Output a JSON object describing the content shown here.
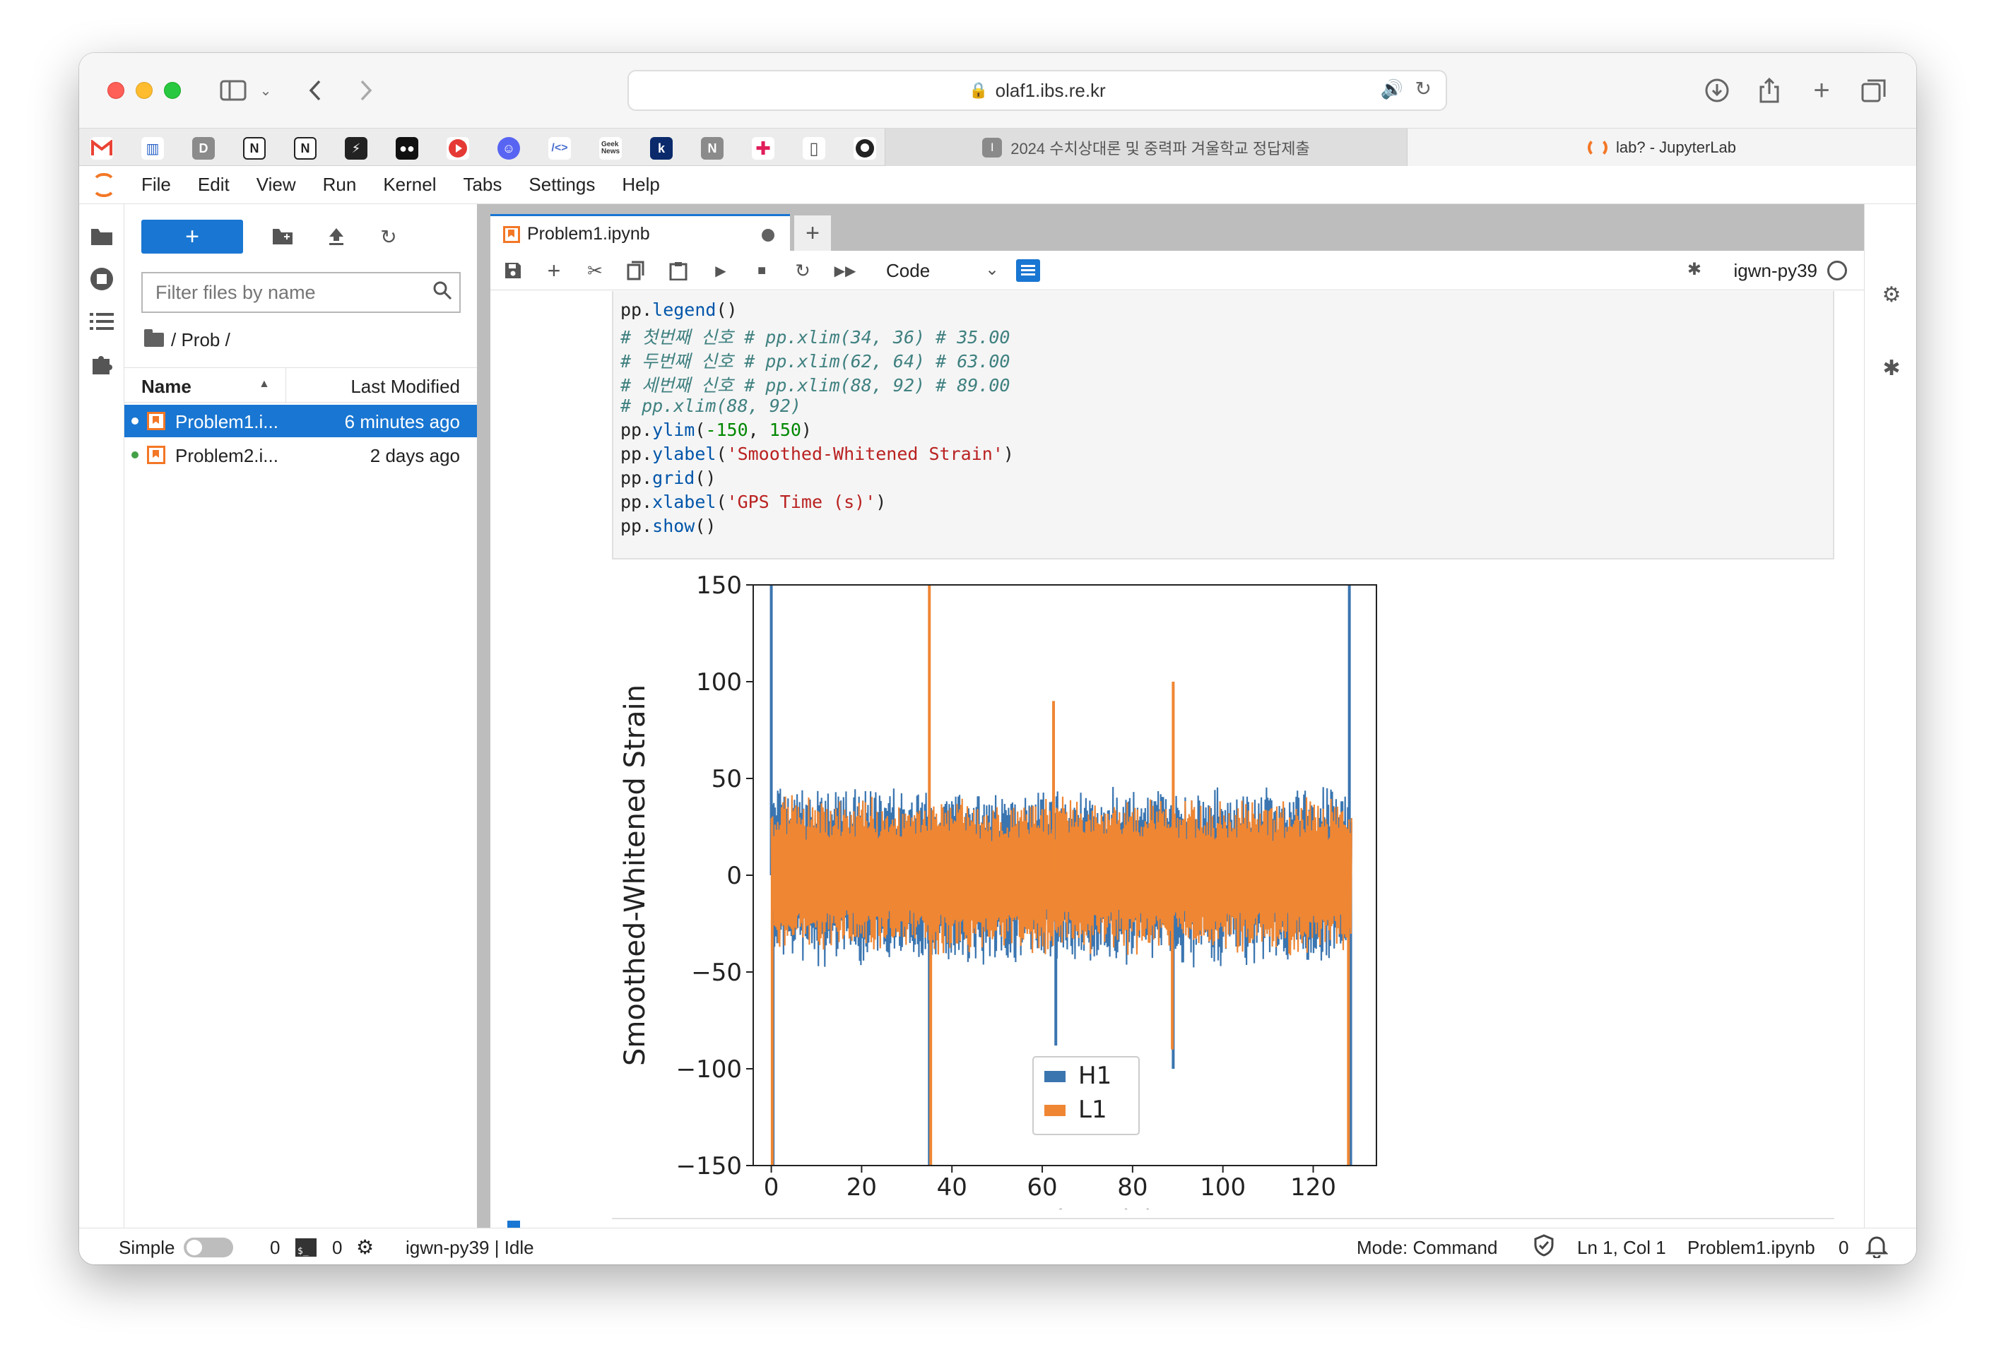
{
  "browser": {
    "url": "olaf1.ibs.re.kr",
    "tabs": [
      {
        "label": "2024 수치상대론 및 중력파 겨울학교 정답제출",
        "favicon": "I",
        "active": false
      },
      {
        "label": "lab? - JupyterLab",
        "active": true
      }
    ],
    "bookmarks": [
      "gmail-icon",
      "bookmark-barcode",
      "D",
      "notion-icon",
      "notion-icon",
      "bookmark-app",
      "medium-icon",
      "youtube-icon",
      "discord-icon",
      "/<>",
      "Geek News",
      "k",
      "N",
      "slack-icon",
      "reader-icon",
      "github-icon"
    ]
  },
  "jupyter": {
    "menu": [
      "File",
      "Edit",
      "View",
      "Run",
      "Kernel",
      "Tabs",
      "Settings",
      "Help"
    ],
    "filebrowser": {
      "new_label": "+",
      "filter_placeholder": "Filter files by name",
      "breadcrumb": "/ Prob /",
      "col_name": "Name",
      "col_modified": "Last Modified",
      "files": [
        {
          "name": "Problem1.i...",
          "modified": "6 minutes ago",
          "selected": true
        },
        {
          "name": "Problem2.i...",
          "modified": "2 days ago",
          "selected": false
        }
      ]
    },
    "tab": {
      "label": "Problem1.ipynb"
    },
    "toolbar": {
      "cell_type": "Code",
      "kernel": "igwn-py39"
    },
    "status": {
      "mode_label": "Simple",
      "terminals": "0",
      "kernels": "0",
      "kernel_state": "igwn-py39 | Idle",
      "mode": "Mode: Command",
      "cursor": "Ln 1, Col 1",
      "file": "Problem1.ipynb",
      "notifications": "0"
    }
  },
  "code_lines": [
    "pp.legend()",
    "# 첫번째 신호 # pp.xlim(34, 36) # 35.00",
    "# 두번째 신호 # pp.xlim(62, 64) # 63.00",
    "# 세번째 신호 # pp.xlim(88, 92) # 89.00",
    "# pp.xlim(88, 92)",
    "pp.ylim(-150, 150)",
    "pp.ylabel('Smoothed-Whitened Strain')",
    "pp.grid()",
    "pp.xlabel('GPS Time (s)')",
    "pp.show()"
  ],
  "chart_data": {
    "type": "line",
    "xlabel": "GPS Time (s)",
    "ylabel": "Smoothed-Whitened Strain",
    "xlim": [
      -4,
      134
    ],
    "ylim": [
      -150,
      150
    ],
    "xticks": [
      0,
      20,
      40,
      60,
      80,
      100,
      120
    ],
    "yticks": [
      150,
      100,
      50,
      0,
      -50,
      -100,
      -150
    ],
    "xtick_labels": [
      "0",
      "20",
      "40",
      "60",
      "80",
      "100",
      "120"
    ],
    "ytick_labels": [
      "150",
      "100",
      "50",
      "0",
      "−50",
      "−100",
      "−150"
    ],
    "legend_position": "bottom-center",
    "grid": false,
    "series": [
      {
        "name": "H1",
        "color": "#3a75b0",
        "band": [
          -45,
          45
        ],
        "spikes": [
          [
            0,
            150
          ],
          [
            0.4,
            -150
          ],
          [
            35,
            -150
          ],
          [
            63,
            -88
          ],
          [
            89,
            -100
          ],
          [
            128,
            150
          ],
          [
            128.3,
            -150
          ]
        ]
      },
      {
        "name": "L1",
        "color": "#ef8633",
        "band": [
          -40,
          40
        ],
        "spikes": [
          [
            0.2,
            -150
          ],
          [
            35,
            150
          ],
          [
            35.3,
            -150
          ],
          [
            62.5,
            90
          ],
          [
            89,
            100
          ],
          [
            88.8,
            -90
          ],
          [
            127.8,
            -150
          ]
        ]
      }
    ]
  }
}
